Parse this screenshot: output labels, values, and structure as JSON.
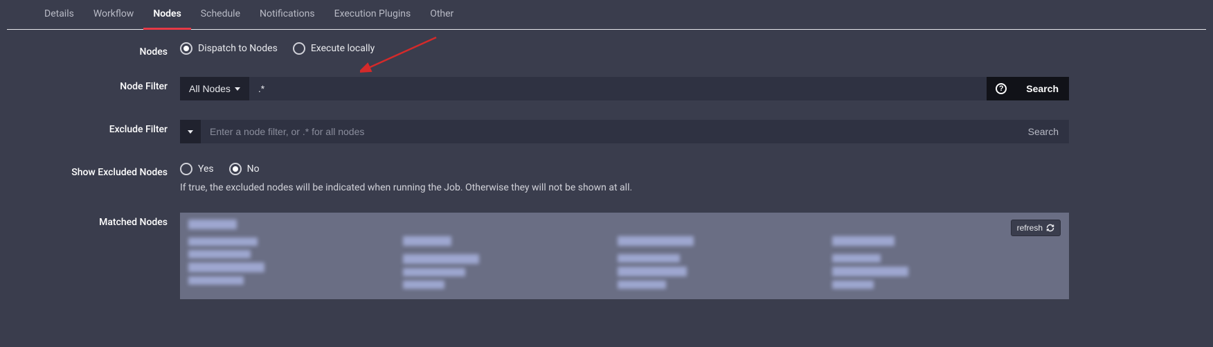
{
  "tabs": [
    {
      "label": "Details"
    },
    {
      "label": "Workflow"
    },
    {
      "label": "Nodes"
    },
    {
      "label": "Schedule"
    },
    {
      "label": "Notifications"
    },
    {
      "label": "Execution Plugins"
    },
    {
      "label": "Other"
    }
  ],
  "active_tab": "Nodes",
  "labels": {
    "nodes": "Nodes",
    "node_filter": "Node Filter",
    "exclude_filter": "Exclude Filter",
    "show_excluded": "Show Excluded Nodes",
    "matched_nodes": "Matched Nodes"
  },
  "radios": {
    "dispatch": "Dispatch to Nodes",
    "execute_locally": "Execute locally",
    "yes": "Yes",
    "no": "No"
  },
  "node_filter": {
    "dropdown_label": "All Nodes",
    "value": ".*",
    "search_label": "Search",
    "help_char": "?"
  },
  "exclude_filter": {
    "placeholder": "Enter a node filter, or .* for all nodes",
    "value": "",
    "search_label": "Search"
  },
  "show_excluded_hint": "If true, the excluded nodes will be indicated when running the Job. Otherwise they will not be shown at all.",
  "matched": {
    "refresh_label": "refresh"
  }
}
